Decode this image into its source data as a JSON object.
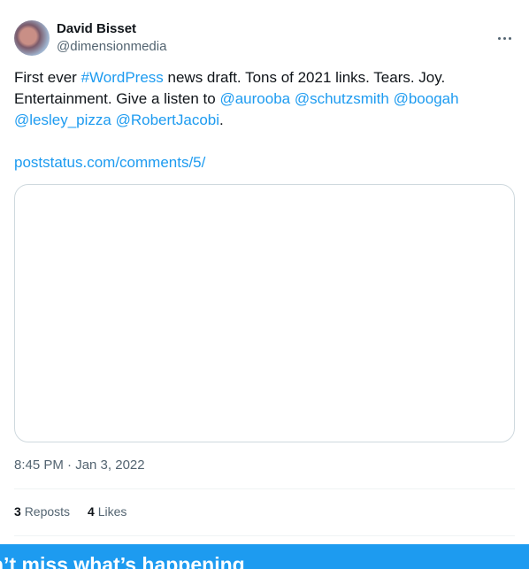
{
  "post": {
    "author": {
      "display_name": "David Bisset",
      "handle": "@dimensionmedia"
    },
    "text": {
      "part1": "First ever ",
      "hashtag": "#WordPress",
      "part2": " news draft. Tons of 2021 links. Tears. Joy. Entertainment. Give a listen to ",
      "mention1": "@aurooba",
      "mention2": "@schutzsmith",
      "mention3": "@boogah",
      "mention4": "@lesley_pizza",
      "mention5": "@RobertJacobi",
      "period": ".",
      "link": "poststatus.com/comments/5/"
    },
    "timestamp": "8:45 PM · Jan 3, 2022",
    "stats": {
      "reposts_count": "3",
      "reposts_label": "Reposts",
      "likes_count": "4",
      "likes_label": "Likes"
    }
  },
  "banner": {
    "text": "n’t miss what’s happening"
  },
  "colors": {
    "accent": "#1d9bf0",
    "text_primary": "#0f1419",
    "text_secondary": "#536471",
    "border": "#cfd9de"
  },
  "icons": {
    "more": "more-horizontal-icon"
  }
}
